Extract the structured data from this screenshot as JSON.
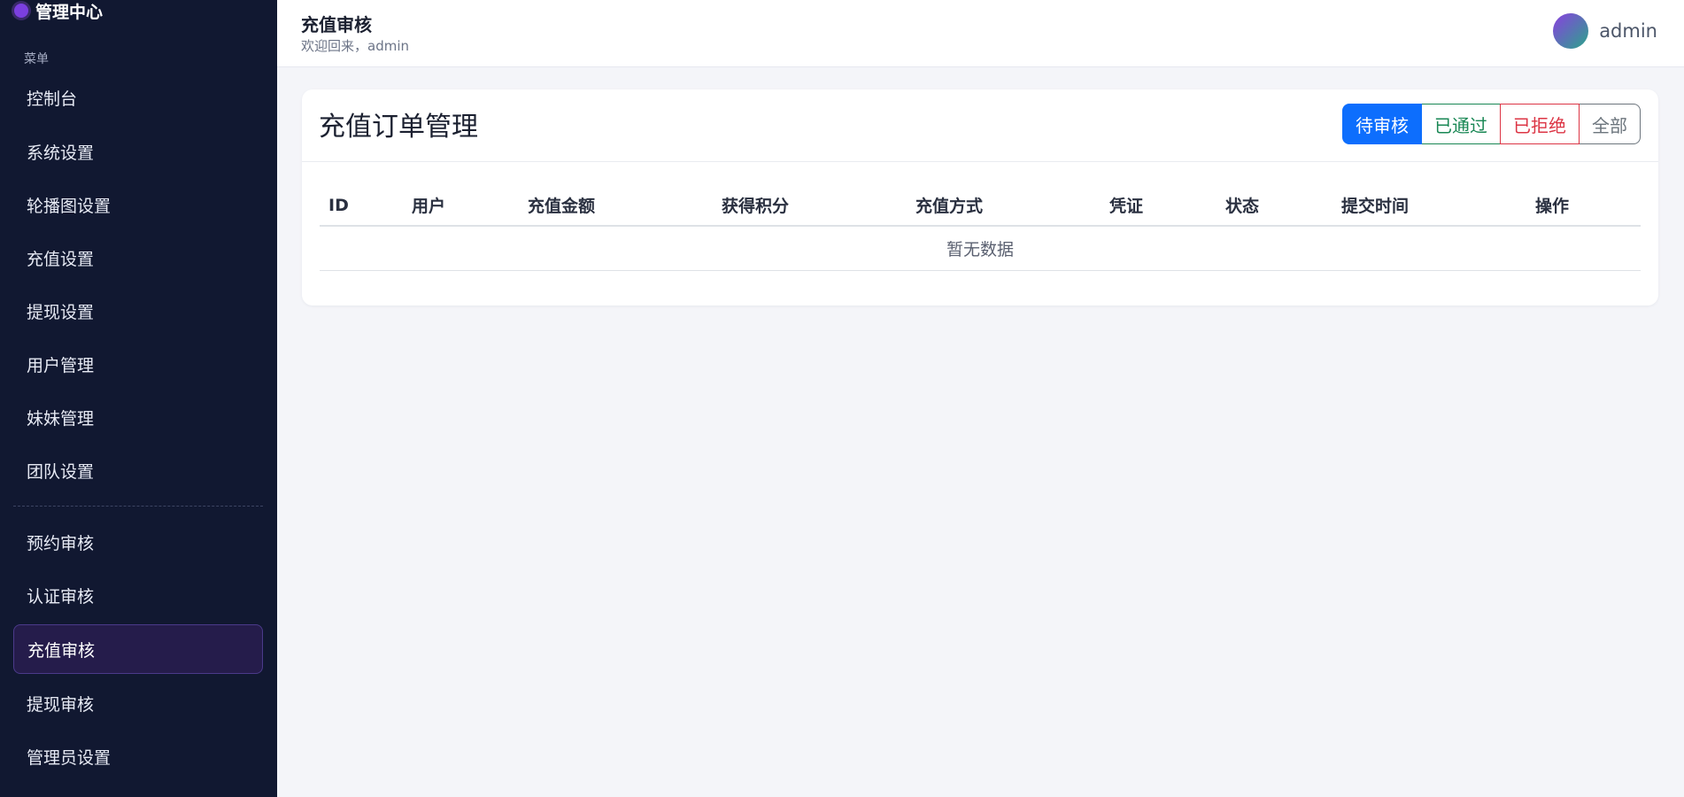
{
  "sidebar": {
    "brand": "管理中心",
    "caption": "菜单",
    "items": [
      {
        "label": "控制台"
      },
      {
        "label": "系统设置"
      },
      {
        "label": "轮播图设置"
      },
      {
        "label": "充值设置"
      },
      {
        "label": "提现设置"
      },
      {
        "label": "用户管理"
      },
      {
        "label": "妹妹管理"
      },
      {
        "label": "团队设置"
      },
      {
        "label": "预约审核"
      },
      {
        "label": "认证审核"
      },
      {
        "label": "充值审核",
        "active": true
      },
      {
        "label": "提现审核"
      },
      {
        "label": "管理员设置"
      }
    ]
  },
  "header": {
    "title": "充值审核",
    "welcome": "欢迎回来，admin",
    "username": "admin"
  },
  "card": {
    "title": "充值订单管理",
    "filters": {
      "pending": "待审核",
      "approved": "已通过",
      "rejected": "已拒绝",
      "all": "全部"
    },
    "columns": [
      "ID",
      "用户",
      "充值金额",
      "获得积分",
      "充值方式",
      "凭证",
      "状态",
      "提交时间",
      "操作"
    ],
    "empty_text": "暂无数据"
  },
  "colors": {
    "sidebar_bg": "#111831",
    "active_item_bg": "#251c4b",
    "primary": "#0d6efd",
    "success": "#198754",
    "danger": "#dc3545",
    "secondary": "#6c757d"
  }
}
